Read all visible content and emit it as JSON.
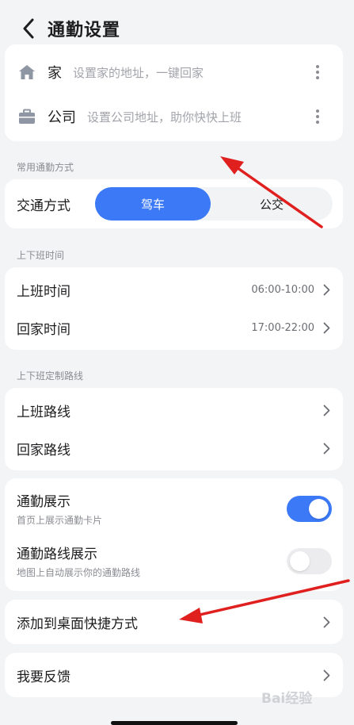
{
  "header": {
    "title": "通勤设置"
  },
  "addresses": [
    {
      "title": "家",
      "hint": "设置家的地址，一键回家",
      "icon": "home-icon"
    },
    {
      "title": "公司",
      "hint": "设置公司地址，助你快快上班",
      "icon": "briefcase-icon"
    }
  ],
  "commute_mode": {
    "section": "常用通勤方式",
    "label": "交通方式",
    "options": [
      "驾车",
      "公交"
    ],
    "selected": "驾车"
  },
  "commute_time": {
    "section": "上下班时间",
    "rows": [
      {
        "label": "上班时间",
        "value": "06:00-10:00"
      },
      {
        "label": "回家时间",
        "value": "17:00-22:00"
      }
    ]
  },
  "routes": {
    "section": "上下班定制路线",
    "rows": [
      {
        "label": "上班路线"
      },
      {
        "label": "回家路线"
      }
    ]
  },
  "display": {
    "rows": [
      {
        "label": "通勤展示",
        "sub": "首页上展示通勤卡片",
        "on": true
      },
      {
        "label": "通勤路线展示",
        "sub": "地图上自动展示你的通勤路线",
        "on": false
      }
    ]
  },
  "shortcut": {
    "label": "添加到桌面快捷方式"
  },
  "feedback": {
    "label": "我要反馈"
  },
  "watermark": "Bai经验",
  "colors": {
    "accent": "#3b79f6",
    "annotation_arrow": "#e0201f"
  }
}
